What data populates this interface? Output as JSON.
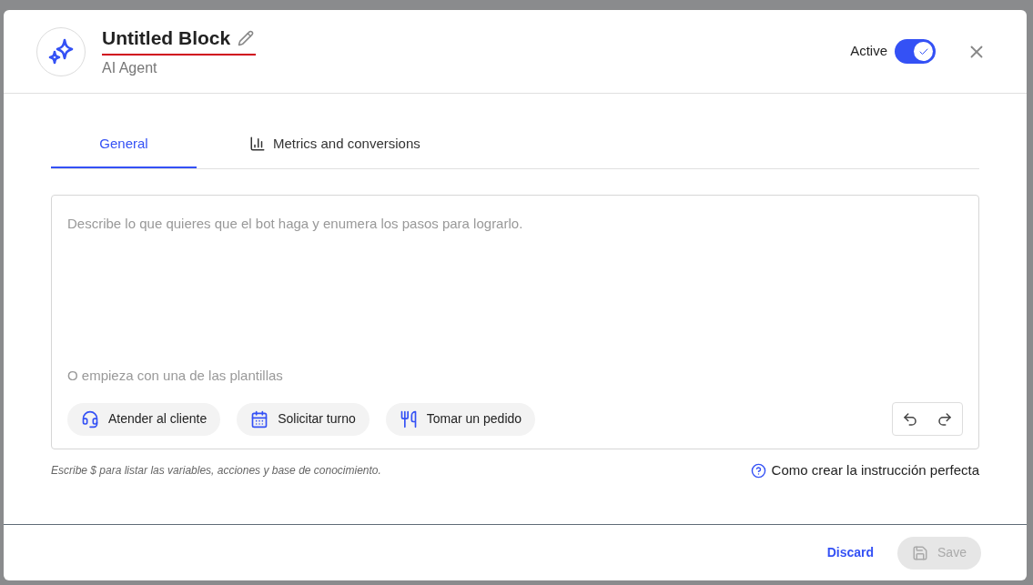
{
  "header": {
    "title": "Untitled Block",
    "subtitle": "AI Agent",
    "active_label": "Active",
    "active": true
  },
  "tabs": [
    {
      "label": "General",
      "selected": true,
      "kind": "plain"
    },
    {
      "label": "Metrics and conversions",
      "selected": false,
      "kind": "chart"
    }
  ],
  "editor": {
    "placeholder": "Describe lo que quieres que el bot haga y enumera los pasos para lograrlo.",
    "templates_label": "O empieza con una de las plantillas",
    "templates": [
      {
        "label": "Atender al cliente",
        "kind": "support"
      },
      {
        "label": "Solicitar turno",
        "kind": "calendar"
      },
      {
        "label": "Tomar un pedido",
        "kind": "order"
      }
    ]
  },
  "hint": "Escribe $ para listar las variables, acciones y base de conocimiento.",
  "help_link": "Como crear la instrucción perfecta",
  "footer": {
    "discard": "Discard",
    "save": "Save",
    "save_disabled": true
  }
}
